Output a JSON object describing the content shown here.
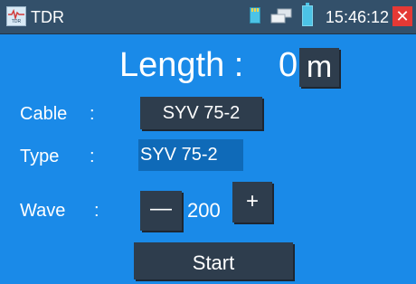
{
  "titlebar": {
    "app_icon": "tdr-app-icon",
    "app_icon_text": "TDR",
    "title": "TDR",
    "status_icons": [
      "sd-card-icon",
      "network-icon",
      "battery-icon"
    ],
    "clock": "15:46:12",
    "close_label": "✕"
  },
  "length": {
    "label": "Length : ",
    "value": "0",
    "unit": "m"
  },
  "cable": {
    "label": "Cable",
    "colon": ":",
    "value": "SYV 75-2"
  },
  "type": {
    "label": "Type",
    "colon": ":",
    "value": "SYV 75-2"
  },
  "wave": {
    "label": "Wave",
    "colon": ":",
    "minus_label": "—",
    "value": "200",
    "plus_label": "+"
  },
  "start": {
    "label": "Start"
  },
  "colors": {
    "background": "#1a8ae8",
    "titlebar": "#33506a",
    "button": "#2e3d4d",
    "type_field": "#0f6ab8",
    "close": "#e53935"
  }
}
